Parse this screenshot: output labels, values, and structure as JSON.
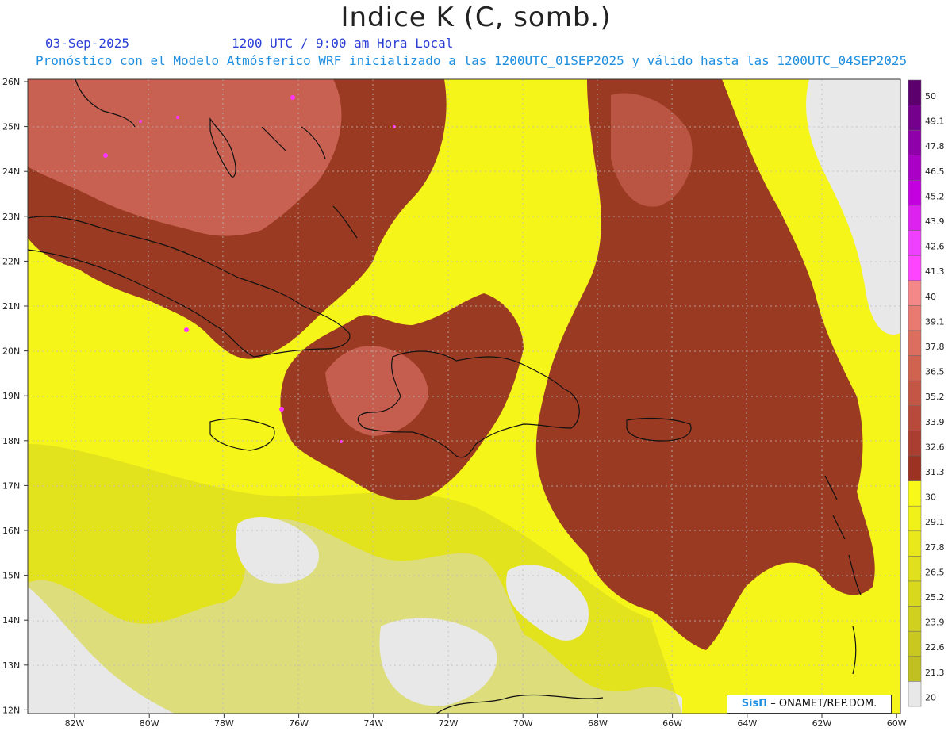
{
  "title": "Indice K (C, somb.)",
  "header": {
    "date": "03-Sep-2025",
    "time": "1200 UTC / 9:00 am Hora Local",
    "forecast": "Pronóstico con el Modelo Atmósferico WRF inicializado a las 1200UTC_01SEP2025 y válido hasta las  1200UTC_04SEP2025"
  },
  "map": {
    "lat_labels": [
      "26N",
      "25N",
      "24N",
      "23N",
      "22N",
      "21N",
      "20N",
      "19N",
      "18N",
      "17N",
      "16N",
      "15N",
      "14N",
      "13N",
      "12N"
    ],
    "lon_labels": [
      "82W",
      "80W",
      "78W",
      "76W",
      "74W",
      "72W",
      "70W",
      "68W",
      "66W",
      "64W",
      "62W",
      "60W"
    ],
    "lat_range": [
      12,
      26
    ],
    "lon_range": [
      -83.2,
      -60.0
    ],
    "colors": {
      "low": "#e8e8e8",
      "yellow": "#f5f51a",
      "dark_yellow": "#d4d420",
      "brown": "#9a3a22",
      "salmon": "#d0685a",
      "magenta": "#ff33ff",
      "coast": "#111111",
      "grid": "#bbbbbb"
    }
  },
  "colorbar": {
    "labels": [
      "50",
      "49.1",
      "47.8",
      "46.5",
      "45.2",
      "43.9",
      "42.6",
      "41.3",
      "40",
      "39.1",
      "37.8",
      "36.5",
      "35.2",
      "33.9",
      "32.6",
      "31.3",
      "30",
      "29.1",
      "27.8",
      "26.5",
      "25.2",
      "23.9",
      "22.6",
      "21.3",
      "20"
    ],
    "colors": [
      "#5c006e",
      "#76008e",
      "#9000aa",
      "#aa00c6",
      "#c400e0",
      "#dd22f0",
      "#f040ff",
      "#ff44ff",
      "#f48888",
      "#e87a72",
      "#dc6e60",
      "#d06250",
      "#c45646",
      "#b84a3c",
      "#aa3e30",
      "#9c3222",
      "#f8f81a",
      "#f0f01a",
      "#e8e81c",
      "#e0e01e",
      "#d8d81e",
      "#d0d020",
      "#c8c820",
      "#c0c022",
      "#e8e8e8"
    ]
  },
  "credit": {
    "logo": "SisΠ",
    "text": "– ONAMET/REP.DOM."
  }
}
